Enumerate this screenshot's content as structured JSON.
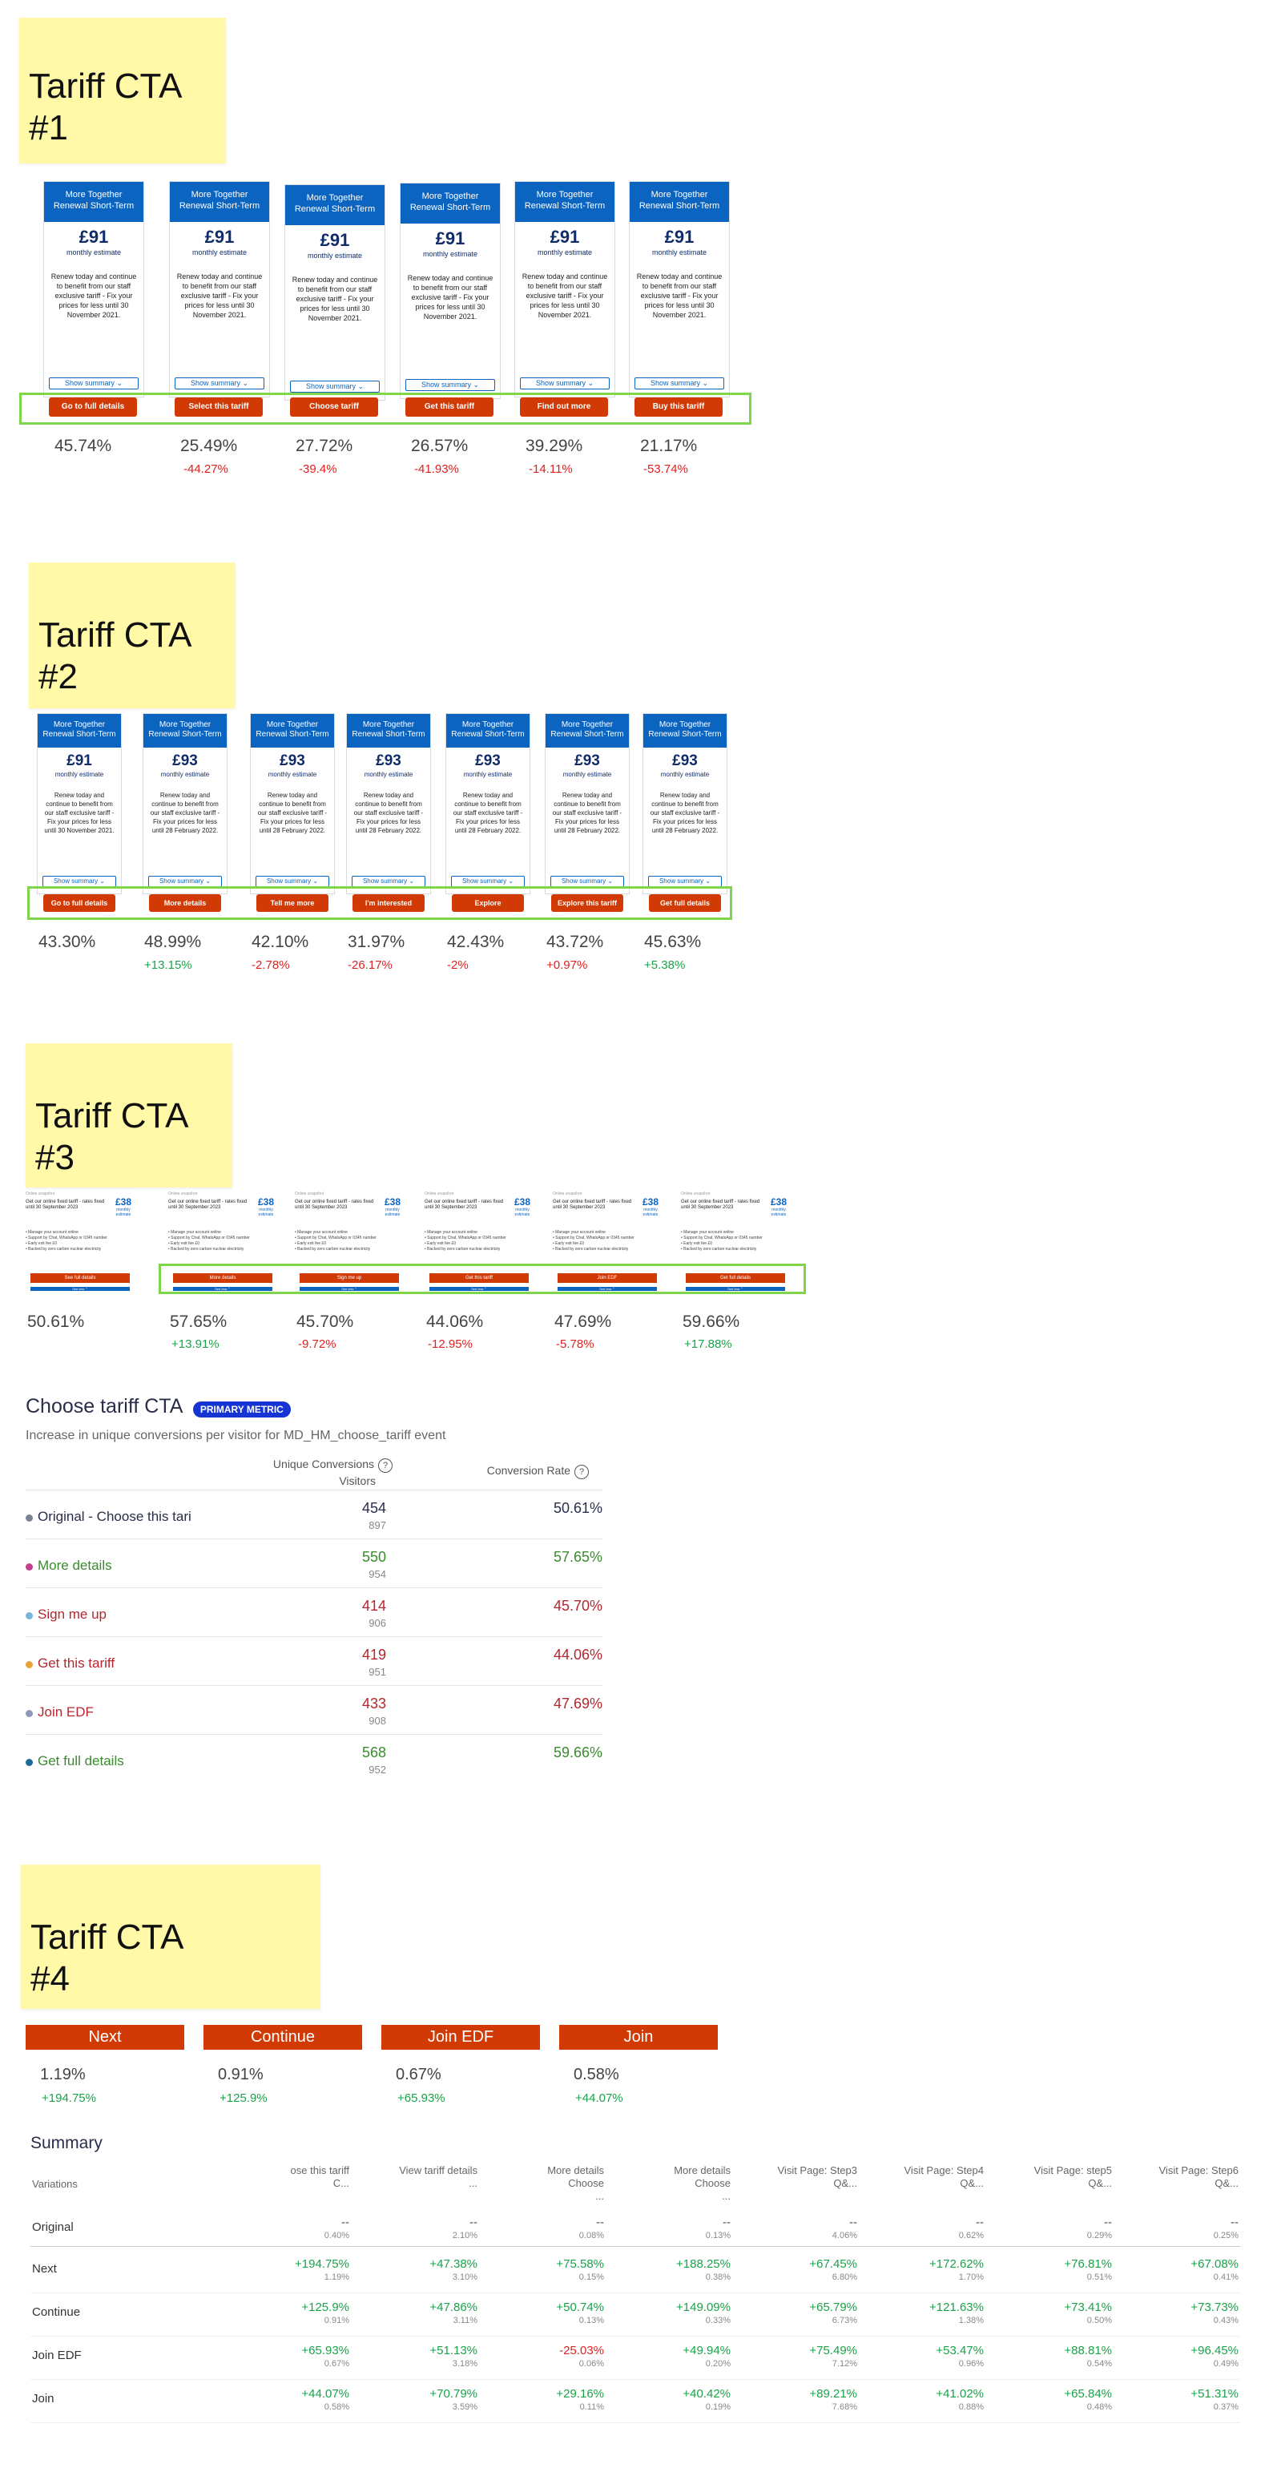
{
  "section1": {
    "sticky_title": "Tariff CTA\n#1",
    "card": {
      "header": "More Together\nRenewal Short-Term",
      "price": "£91",
      "monthly": "monthly estimate",
      "desc": "Renew today and continue to benefit from our staff exclusive tariff - Fix your prices for less until 30 November 2021.",
      "show_summary": "Show summary ⌄"
    },
    "variants": [
      {
        "cta": "Go to full details",
        "rate": "45.74%",
        "delta": ""
      },
      {
        "cta": "Select this tariff",
        "rate": "25.49%",
        "delta": "-44.27%"
      },
      {
        "cta": "Choose tariff",
        "rate": "27.72%",
        "delta": "-39.4%"
      },
      {
        "cta": "Get this tariff",
        "rate": "26.57%",
        "delta": "-41.93%"
      },
      {
        "cta": "Find out more",
        "rate": "39.29%",
        "delta": "-14.11%"
      },
      {
        "cta": "Buy this tariff",
        "rate": "21.17%",
        "delta": "-53.74%"
      }
    ]
  },
  "section2": {
    "sticky_title": "Tariff CTA\n#2",
    "card": {
      "header": "More Together\nRenewal Short-Term",
      "price_first": "£91",
      "price": "£93",
      "monthly": "monthly estimate",
      "desc_first": "Renew today and continue to benefit from our staff exclusive tariff - Fix your prices for less until 30 November 2021.",
      "desc": "Renew today and continue to benefit from our staff exclusive tariff - Fix your prices for less until 28 February 2022.",
      "show_summary": "Show summary ⌄"
    },
    "variants": [
      {
        "cta": "Go to full details",
        "rate": "43.30%",
        "delta": "",
        "dir": ""
      },
      {
        "cta": "More details",
        "rate": "48.99%",
        "delta": "+13.15%",
        "dir": "pos"
      },
      {
        "cta": "Tell me more",
        "rate": "42.10%",
        "delta": "-2.78%",
        "dir": "neg"
      },
      {
        "cta": "I'm interested",
        "rate": "31.97%",
        "delta": "-26.17%",
        "dir": "neg"
      },
      {
        "cta": "Explore",
        "rate": "42.43%",
        "delta": "-2%",
        "dir": "neg"
      },
      {
        "cta": "Explore this tariff",
        "rate": "43.72%",
        "delta": "+0.97%",
        "dir": "neg"
      },
      {
        "cta": "Get full details",
        "rate": "45.63%",
        "delta": "+5.38%",
        "dir": "pos"
      }
    ]
  },
  "section3": {
    "sticky_title": "Tariff CTA\n#3",
    "mini": {
      "small": "Online snapshot",
      "text": "Get our online fixed tariff - rates fixed until 30 September 2023",
      "price": "£38",
      "price_note": "monthly estimate",
      "b1": "• Manage your account online",
      "b2": "• Support by Chat, WhatsApp or 0345 number",
      "b3": "• Early exit fee £0",
      "b4": "• Backed by zero carbon nuclear electricity",
      "see_less": "See less ⌃"
    },
    "variants": [
      {
        "cta": "See full details",
        "rate": "50.61%",
        "delta": "",
        "dir": ""
      },
      {
        "cta": "More details",
        "rate": "57.65%",
        "delta": "+13.91%",
        "dir": "pos"
      },
      {
        "cta": "Sign me up",
        "rate": "45.70%",
        "delta": "-9.72%",
        "dir": "neg"
      },
      {
        "cta": "Get this tariff",
        "rate": "44.06%",
        "delta": "-12.95%",
        "dir": "neg"
      },
      {
        "cta": "Join EDF",
        "rate": "47.69%",
        "delta": "-5.78%",
        "dir": "neg"
      },
      {
        "cta": "Get full details",
        "rate": "59.66%",
        "delta": "+17.88%",
        "dir": "pos"
      }
    ]
  },
  "metric": {
    "title": "Choose tariff CTA",
    "badge": "PRIMARY METRIC",
    "subtitle": "Increase in unique conversions per visitor for MD_HM_choose_tariff event",
    "col1_line1": "Unique Conversions",
    "col1_line2": "Visitors",
    "col2": "Conversion Rate",
    "help": "?",
    "rows": [
      {
        "name": "Original - Choose this tari",
        "conv": "454",
        "visitors": "897",
        "rate": "50.61%",
        "dot": "#7c8494",
        "color": "#2a2d4a"
      },
      {
        "name": "More details",
        "conv": "550",
        "visitors": "954",
        "rate": "57.65%",
        "dot": "#c2408c",
        "color": "#3a8a2e"
      },
      {
        "name": "Sign me up",
        "conv": "414",
        "visitors": "906",
        "rate": "45.70%",
        "dot": "#7ab6d6",
        "color": "#b5262e"
      },
      {
        "name": "Get this tariff",
        "conv": "419",
        "visitors": "951",
        "rate": "44.06%",
        "dot": "#e8a23a",
        "color": "#b5262e"
      },
      {
        "name": "Join EDF",
        "conv": "433",
        "visitors": "908",
        "rate": "47.69%",
        "dot": "#8b9ab8",
        "color": "#b5262e"
      },
      {
        "name": "Get full details",
        "conv": "568",
        "visitors": "952",
        "rate": "59.66%",
        "dot": "#1c6a96",
        "color": "#3a8a2e"
      }
    ]
  },
  "section4": {
    "sticky_title": "Tariff CTA\n#4",
    "variants": [
      {
        "cta": "Next",
        "rate": "1.19%",
        "delta": "+194.75%"
      },
      {
        "cta": "Continue",
        "rate": "0.91%",
        "delta": "+125.9%"
      },
      {
        "cta": "Join EDF",
        "rate": "0.67%",
        "delta": "+65.93%"
      },
      {
        "cta": "Join",
        "rate": "0.58%",
        "delta": "+44.07%"
      }
    ]
  },
  "summary": {
    "title": "Summary",
    "variations_header": "Variations",
    "columns": [
      "ose this tariff\nC...",
      "View tariff details ...",
      "More details Choose\n...",
      "More details Choose\n...",
      "Visit Page: Step3\nQ&...",
      "Visit Page: Step4\nQ&...",
      "Visit Page: step5\nQ&...",
      "Visit Page: Step6\nQ&..."
    ],
    "rows": [
      {
        "label": "Original",
        "cells": [
          [
            "--",
            "0.40%"
          ],
          [
            "--",
            "2.10%"
          ],
          [
            "--",
            "0.08%"
          ],
          [
            "--",
            "0.13%"
          ],
          [
            "--",
            "4.06%"
          ],
          [
            "--",
            "0.62%"
          ],
          [
            "--",
            "0.29%"
          ],
          [
            "--",
            "0.25%"
          ]
        ]
      },
      {
        "label": "Next",
        "cells": [
          [
            "+194.75%",
            "1.19%"
          ],
          [
            "+47.38%",
            "3.10%"
          ],
          [
            "+75.58%",
            "0.15%"
          ],
          [
            "+188.25%",
            "0.38%"
          ],
          [
            "+67.45%",
            "6.80%"
          ],
          [
            "+172.62%",
            "1.70%"
          ],
          [
            "+76.81%",
            "0.51%"
          ],
          [
            "+67.08%",
            "0.41%"
          ]
        ]
      },
      {
        "label": "Continue",
        "cells": [
          [
            "+125.9%",
            "0.91%"
          ],
          [
            "+47.86%",
            "3.11%"
          ],
          [
            "+50.74%",
            "0.13%"
          ],
          [
            "+149.09%",
            "0.33%"
          ],
          [
            "+65.79%",
            "6.73%"
          ],
          [
            "+121.63%",
            "1.38%"
          ],
          [
            "+73.41%",
            "0.50%"
          ],
          [
            "+73.73%",
            "0.43%"
          ]
        ]
      },
      {
        "label": "Join EDF",
        "cells": [
          [
            "+65.93%",
            "0.67%"
          ],
          [
            "+51.13%",
            "3.18%"
          ],
          [
            "-25.03%",
            "0.06%"
          ],
          [
            "+49.94%",
            "0.20%"
          ],
          [
            "+75.49%",
            "7.12%"
          ],
          [
            "+53.47%",
            "0.96%"
          ],
          [
            "+88.81%",
            "0.54%"
          ],
          [
            "+96.45%",
            "0.49%"
          ]
        ]
      },
      {
        "label": "Join",
        "cells": [
          [
            "+44.07%",
            "0.58%"
          ],
          [
            "+70.79%",
            "3.59%"
          ],
          [
            "+29.16%",
            "0.11%"
          ],
          [
            "+40.42%",
            "0.19%"
          ],
          [
            "+89.21%",
            "7.68%"
          ],
          [
            "+41.02%",
            "0.88%"
          ],
          [
            "+65.84%",
            "0.48%"
          ],
          [
            "+51.31%",
            "0.37%"
          ]
        ]
      }
    ],
    "positive_color": "#1aa34a",
    "negative_color": "#e02020"
  }
}
